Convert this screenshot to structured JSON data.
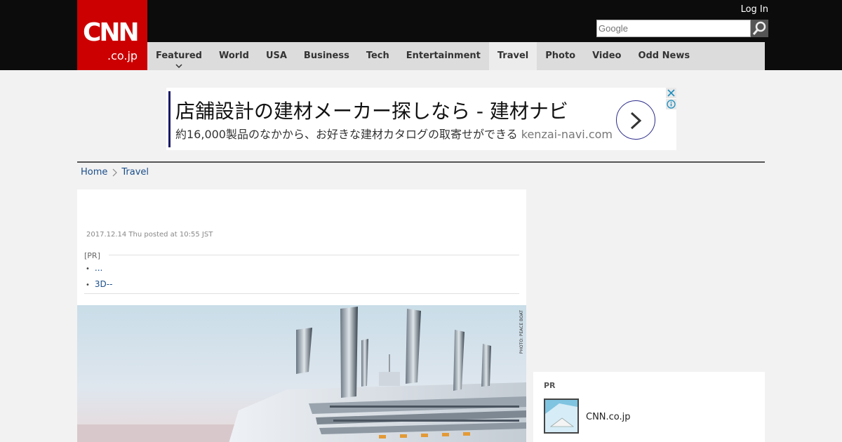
{
  "header": {
    "logo_main": "CNN",
    "logo_sub": ".co.jp",
    "login_label": "Log In",
    "search_placeholder": "Google"
  },
  "nav": {
    "items": [
      "Featured",
      "World",
      "USA",
      "Business",
      "Tech",
      "Entertainment",
      "Travel",
      "Photo",
      "Video",
      "Odd News"
    ],
    "active": "Travel"
  },
  "ad": {
    "title": "店舗設計の建材メーカー探しなら - 建材ナビ",
    "subtitle": "約16,000製品のなかから、お好きな建材カタログの取寄せができる",
    "url": "kenzai-navi.com"
  },
  "breadcrumb": {
    "home": "Home",
    "current": "Travel"
  },
  "article": {
    "date": "2017.12.14 Thu posted at 10:55 JST",
    "pr_label": "[PR]",
    "pr_links": [
      "...",
      "3D--"
    ],
    "photo_credit": "PHOTO: PEACE BOAT"
  },
  "sidebar": {
    "pr_label": "PR",
    "item_text": "CNN.co.jp"
  },
  "colors": {
    "header_bg": "#0c0c0c",
    "logo_red": "#cc0000",
    "nav_bg": "#dcdcdc",
    "link_blue": "#1a4e8a"
  }
}
